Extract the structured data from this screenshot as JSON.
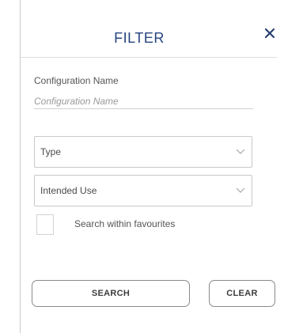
{
  "panel": {
    "title": "FILTER",
    "close_icon": "close-icon"
  },
  "configuration_name": {
    "label": "Configuration Name",
    "value": "",
    "placeholder": "Configuration Name"
  },
  "type_select": {
    "selected_label": "Type",
    "icon": "chevron-down-icon"
  },
  "intended_use_select": {
    "selected_label": "Intended Use",
    "icon": "chevron-down-icon"
  },
  "favourites": {
    "checked": false,
    "label": "Search within favourites"
  },
  "actions": {
    "search_label": "SEARCH",
    "clear_label": "CLEAR"
  }
}
